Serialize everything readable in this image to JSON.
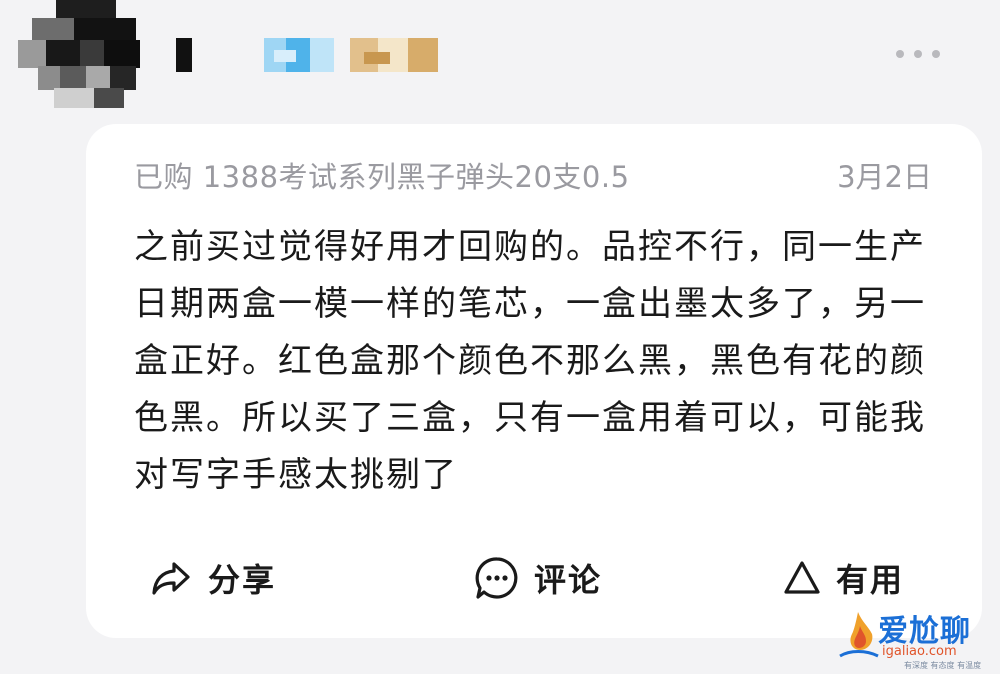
{
  "review": {
    "purchase_info": "已购 1388考试系列黑子弹头20支0.5",
    "date": "3月2日",
    "text": "之前买过觉得好用才回购的。品控不行，同一生产日期两盒一模一样的笔芯，一盒出墨太多了，另一盒正好。红色盒那个颜色不那么黑，黑色有花的颜色黑。所以买了三盒，只有一盒用着可以，可能我对写字手感太挑剔了"
  },
  "actions": {
    "share_label": "分享",
    "comment_label": "评论",
    "useful_label": "有用"
  },
  "icons": {
    "share": "share-arrow-icon",
    "comment": "comment-bubble-icon",
    "useful": "triangle-icon",
    "more": "more-dots-icon"
  },
  "watermark": {
    "title": "爱尬聊",
    "url": "igaliao.com",
    "tagline": "有深度 有态度 有温度"
  },
  "colors": {
    "page_background": "#f3f3f5",
    "card_background": "#ffffff",
    "meta_text": "#9a9aa0",
    "body_text": "#1a1a1a",
    "watermark_blue": "#1b6fd6",
    "watermark_orange": "#e0552b"
  }
}
